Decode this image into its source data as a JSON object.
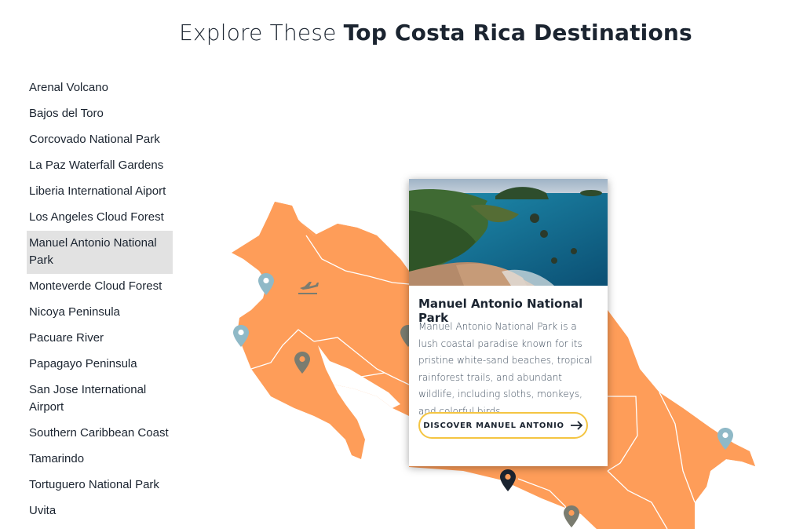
{
  "header": {
    "title_light": "Explore These",
    "title_bold": "Top Costa Rica Destinations"
  },
  "sidebar": {
    "items": [
      {
        "label": "Arenal Volcano"
      },
      {
        "label": "Bajos del Toro"
      },
      {
        "label": "Corcovado National Park"
      },
      {
        "label": "La Paz Waterfall Gardens"
      },
      {
        "label": "Liberia International Aiport"
      },
      {
        "label": "Los Angeles Cloud Forest"
      },
      {
        "label": "Manuel Antonio National Park",
        "active": true
      },
      {
        "label": "Monteverde Cloud Forest"
      },
      {
        "label": "Nicoya Peninsula"
      },
      {
        "label": "Pacuare River"
      },
      {
        "label": "Papagayo Peninsula"
      },
      {
        "label": "San Jose International Airport"
      },
      {
        "label": "Southern Caribbean Coast"
      },
      {
        "label": "Tamarindo"
      },
      {
        "label": "Tortuguero National Park"
      },
      {
        "label": "Uvita"
      }
    ]
  },
  "card": {
    "title": "Manuel Antonio National Park",
    "description": "Manuel Antonio National Park is a lush coastal paradise known for its pristine white-sand beaches, tropical rainforest trails, and abundant wildlife, including sloths, monkeys, and colorful birds.",
    "button_label": "DISCOVER MANUEL ANTONIO",
    "button_icon": "arrow-right-icon"
  },
  "colors": {
    "map_fill": "#fe9d59",
    "map_borders": "#ffffff",
    "pin_default": "#8fb9c7",
    "pin_dark": "#7a7c70",
    "pin_active": "#1b2430",
    "button_border": "#f4c542",
    "active_item_bg": "#e2e2e2"
  },
  "map": {
    "icons": [
      "map-pin-icon",
      "airplane-icon"
    ]
  }
}
